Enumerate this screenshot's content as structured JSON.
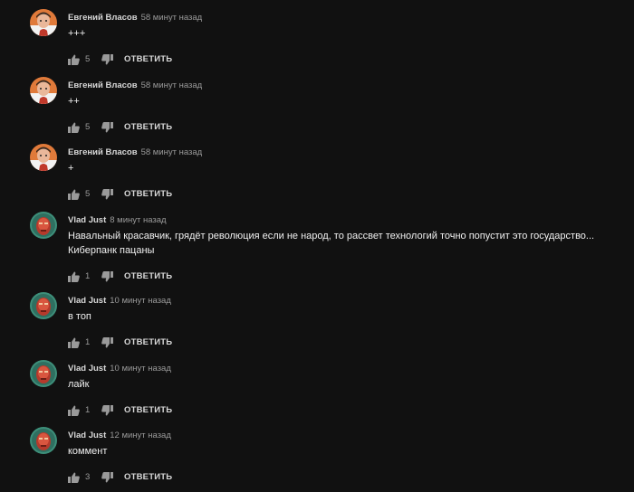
{
  "colors": {
    "background": "#111111",
    "author": "#d9d9d9",
    "meta": "#9a9a9a",
    "text": "#f0f0f0"
  },
  "icons": {
    "like": "thumbs-up-icon",
    "dislike": "thumbs-down-icon"
  },
  "comments": [
    {
      "author": "Евгений Власов",
      "time": "58 минут назад",
      "text": "+++",
      "likes": "5",
      "reply_label": "ОТВЕТИТЬ",
      "avatar": "evgeny"
    },
    {
      "author": "Евгений Власов",
      "time": "58 минут назад",
      "text": "++",
      "likes": "5",
      "reply_label": "ОТВЕТИТЬ",
      "avatar": "evgeny"
    },
    {
      "author": "Евгений Власов",
      "time": "58 минут назад",
      "text": "+",
      "likes": "5",
      "reply_label": "ОТВЕТИТЬ",
      "avatar": "evgeny"
    },
    {
      "author": "Vlad Just",
      "time": "8 минут назад",
      "text": "Навальный красавчик, грядёт революция если не народ, то рассвет технологий точно попустит это государство...\nКиберпанк пацаны",
      "likes": "1",
      "reply_label": "ОТВЕТИТЬ",
      "avatar": "vlad"
    },
    {
      "author": "Vlad Just",
      "time": "10 минут назад",
      "text": "в топ",
      "likes": "1",
      "reply_label": "ОТВЕТИТЬ",
      "avatar": "vlad"
    },
    {
      "author": "Vlad Just",
      "time": "10 минут назад",
      "text": "лайк",
      "likes": "1",
      "reply_label": "ОТВЕТИТЬ",
      "avatar": "vlad"
    },
    {
      "author": "Vlad Just",
      "time": "12 минут назад",
      "text": "коммент",
      "likes": "3",
      "reply_label": "ОТВЕТИТЬ",
      "avatar": "vlad"
    }
  ]
}
